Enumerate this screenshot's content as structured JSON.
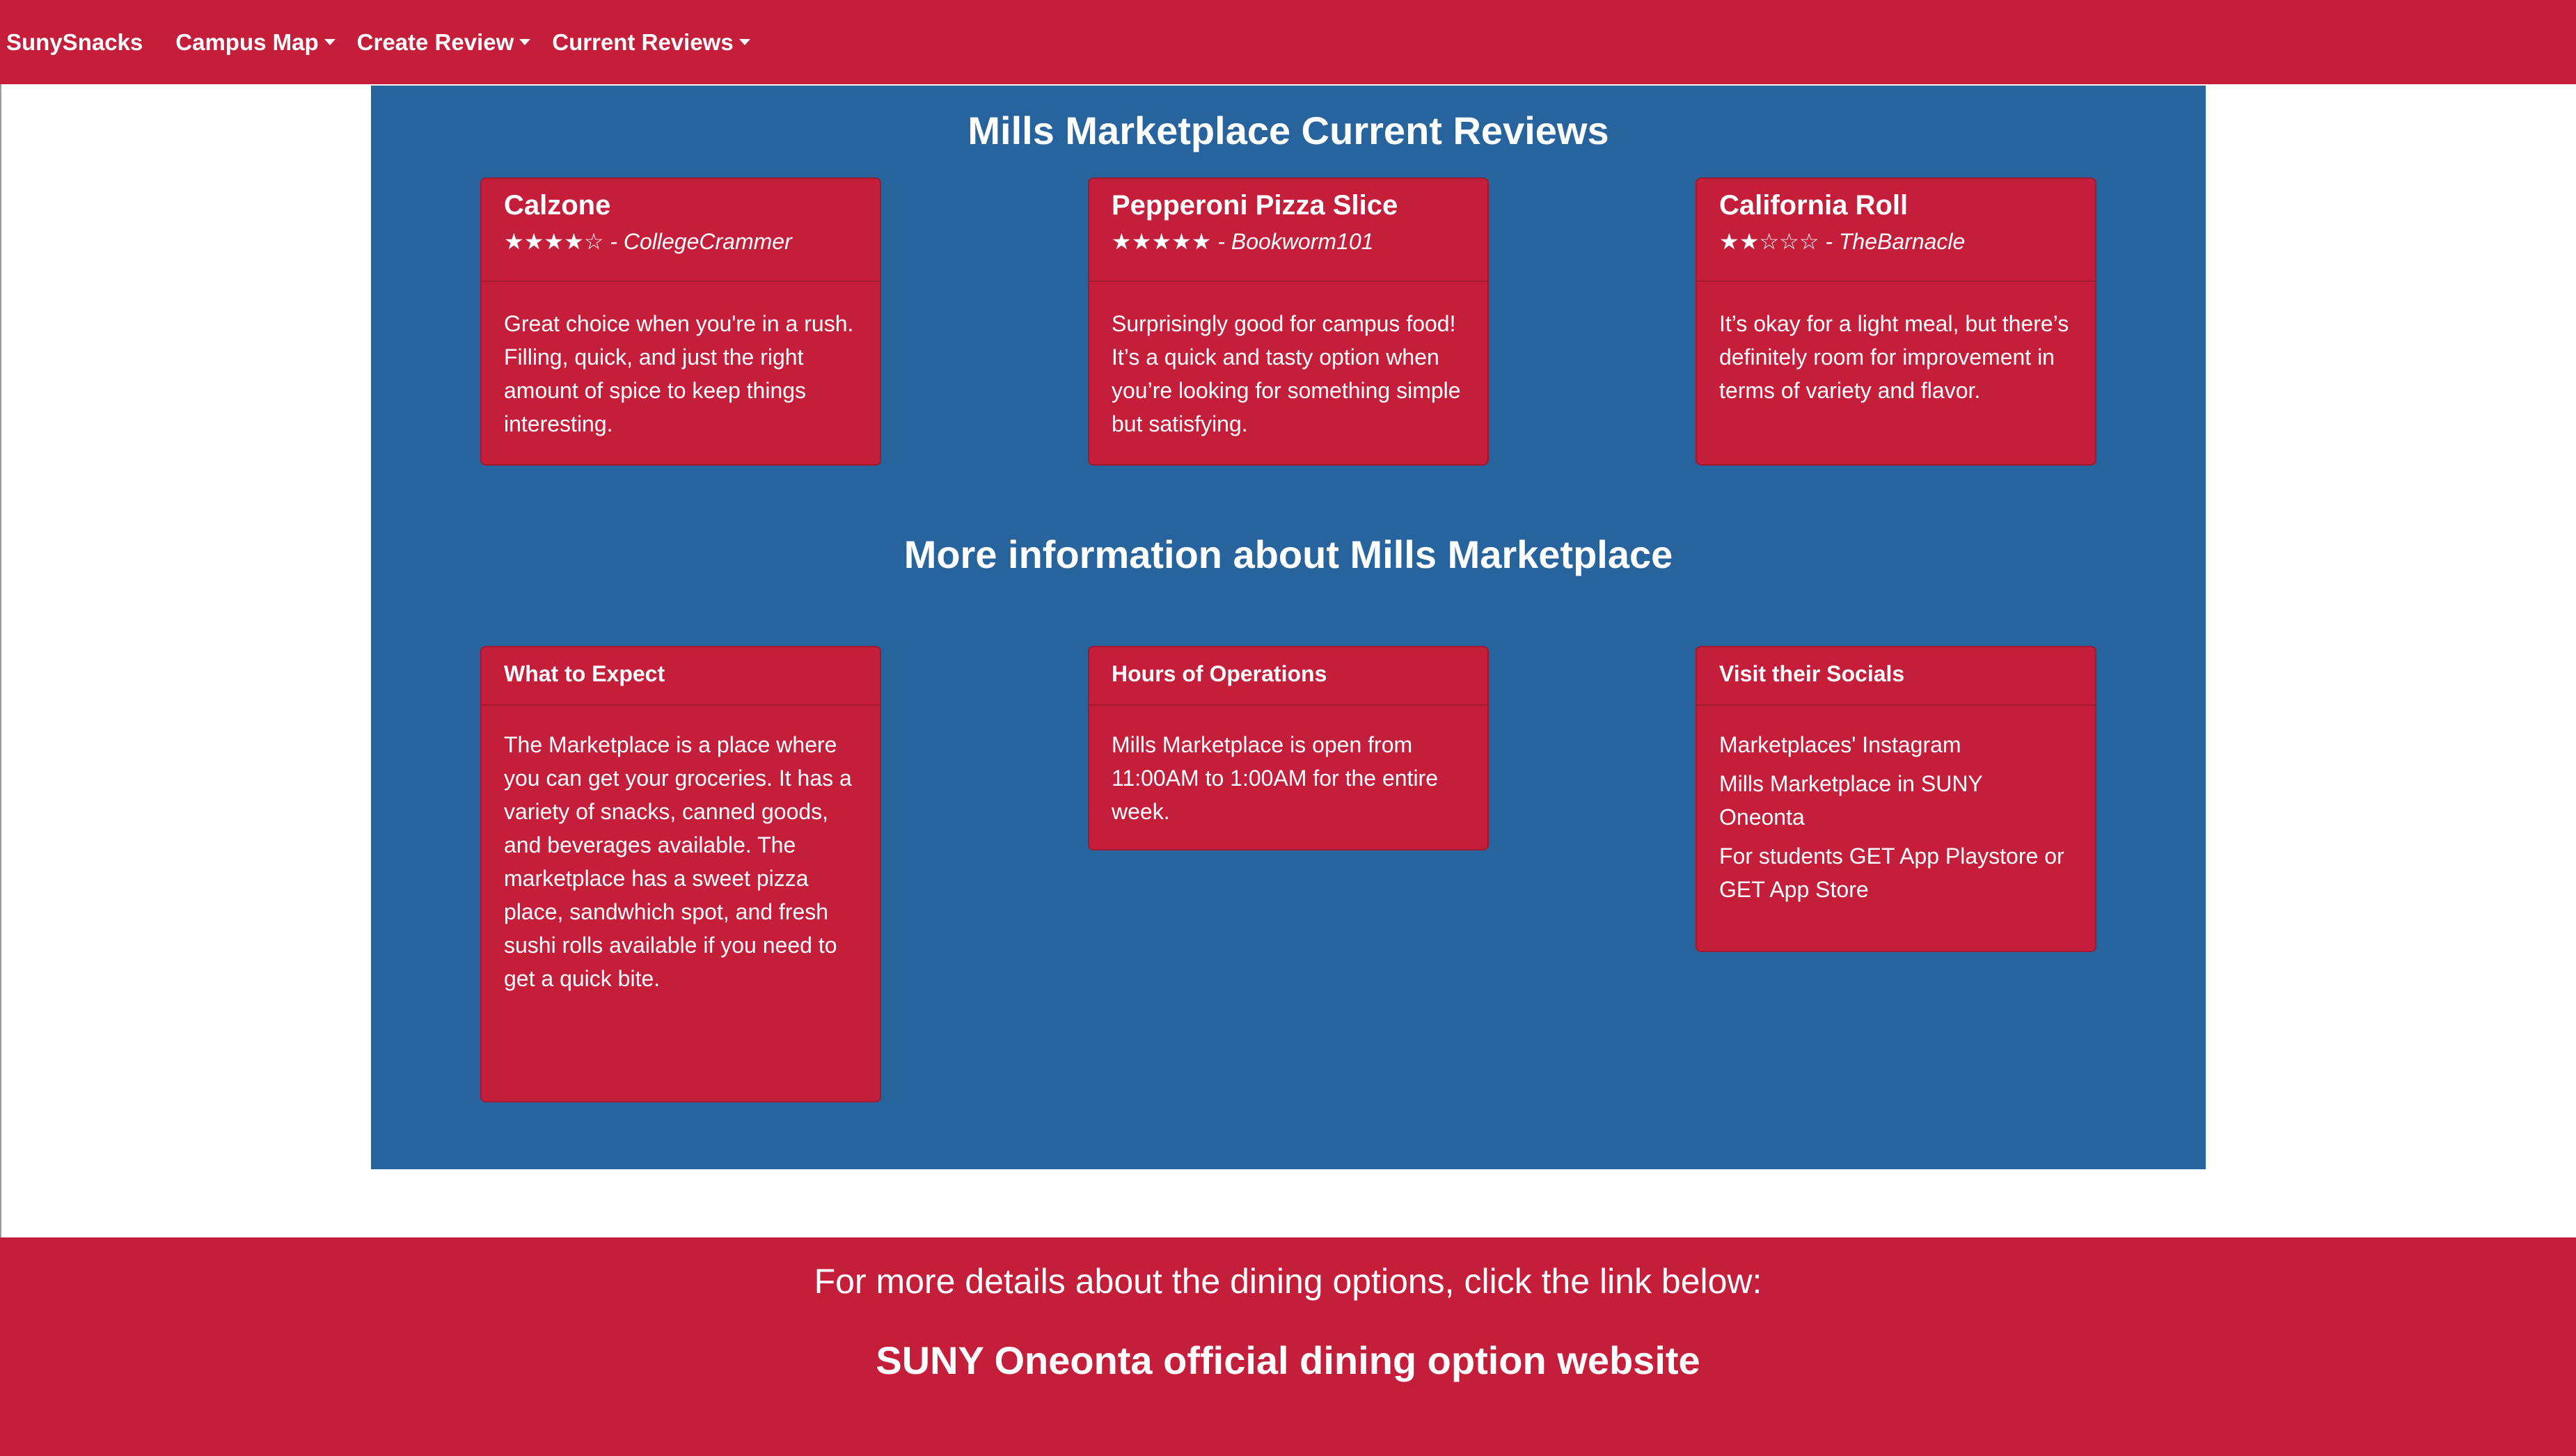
{
  "navbar": {
    "brand": "SunySnacks",
    "items": [
      {
        "label": "Campus Map"
      },
      {
        "label": "Create Review"
      },
      {
        "label": "Current Reviews"
      }
    ]
  },
  "reviews": {
    "heading": "Mills Marketplace Current Reviews",
    "cards": [
      {
        "item": "Calzone",
        "stars": "★★★★☆",
        "reviewer": "CollegeCrammer",
        "text": "Great choice when you're in a rush. Filling, quick, and just the right amount of spice to keep things interesting."
      },
      {
        "item": "Pepperoni Pizza Slice",
        "stars": "★★★★★",
        "reviewer": "Bookworm101",
        "text": "Surprisingly good for campus food! It’s a quick and tasty option when you’re looking for something simple but satisfying."
      },
      {
        "item": "California Roll",
        "stars": "★★☆☆☆",
        "reviewer": "TheBarnacle",
        "text": "It’s okay for a light meal, but there’s definitely room for improvement in terms of variety and flavor."
      }
    ]
  },
  "info": {
    "heading": "More information about Mills Marketplace",
    "expect": {
      "title": "What to Expect",
      "text": "The Marketplace is a place where you can get your groceries. It has a variety of snacks, canned goods, and beverages available. The marketplace has a sweet pizza place, sandwhich spot, and fresh sushi rolls available if you need to get a quick bite."
    },
    "hours": {
      "title": "Hours of Operations",
      "text": "Mills Marketplace is open from 11:00AM to 1:00AM for the entire week."
    },
    "socials": {
      "title": "Visit their Socials",
      "links": [
        "Marketplaces' Instagram",
        "Mills Marketplace in SUNY Oneonta",
        "For students GET App Playstore or GET App Store"
      ]
    }
  },
  "footer": {
    "text": "For more details about the dining options, click the link below:",
    "link": "SUNY Oneonta official dining option website"
  },
  "colors": {
    "brand_red": "#c41e3a",
    "panel_blue": "#27649e",
    "text": "#ffffff"
  }
}
